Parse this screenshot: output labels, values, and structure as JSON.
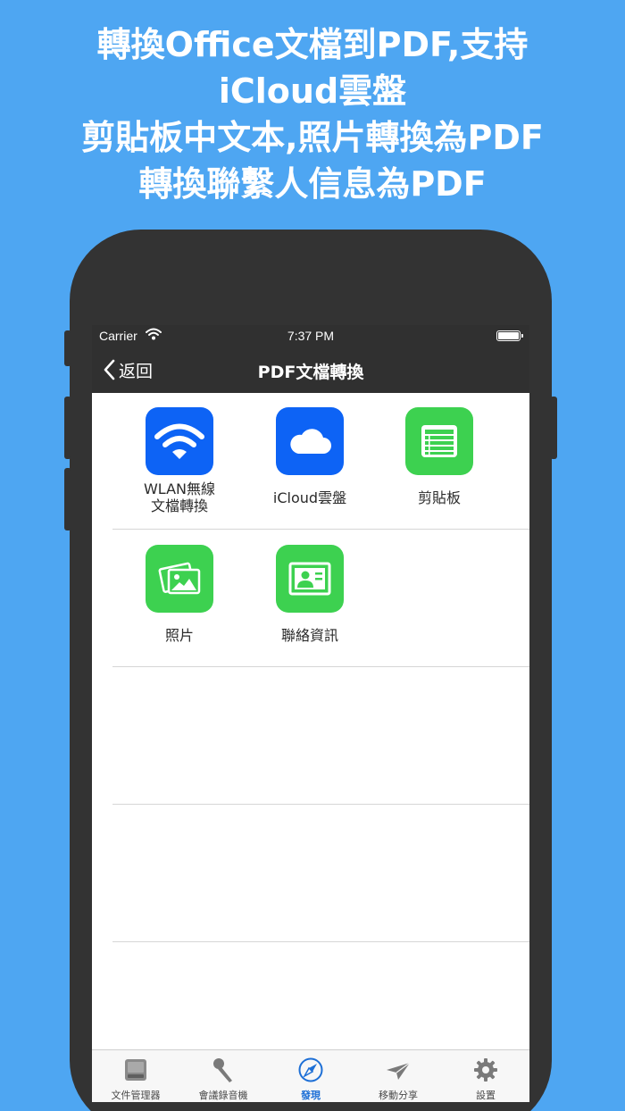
{
  "headline": {
    "lines": [
      "轉換Office文檔到PDF,支持",
      "iCloud雲盤",
      "剪貼板中文本,照片轉換為PDF",
      "轉換聯繫人信息為PDF"
    ]
  },
  "status_bar": {
    "carrier": "Carrier",
    "time": "7:37 PM"
  },
  "nav": {
    "back_label": "返回",
    "title": "PDF文檔轉換"
  },
  "tiles": [
    {
      "label_line1": "WLAN無線",
      "label_line2": "文檔轉換",
      "icon": "wifi-icon",
      "color": "#0d63f5"
    },
    {
      "label_line1": "iCloud雲盤",
      "label_line2": "",
      "icon": "cloud-icon",
      "color": "#0d63f5"
    },
    {
      "label_line1": "剪貼板",
      "label_line2": "",
      "icon": "clipboard-list-icon",
      "color": "#3dd150"
    },
    {
      "label_line1": "照片",
      "label_line2": "",
      "icon": "photos-icon",
      "color": "#3dd150"
    },
    {
      "label_line1": "聯絡資訊",
      "label_line2": "",
      "icon": "contact-card-icon",
      "color": "#3dd150"
    }
  ],
  "tabbar": {
    "tabs": [
      {
        "label": "文件管理器",
        "icon": "drive-icon",
        "active": false
      },
      {
        "label": "會議錄音機",
        "icon": "microphone-icon",
        "active": false
      },
      {
        "label": "發現",
        "icon": "compass-icon",
        "active": true
      },
      {
        "label": "移動分享",
        "icon": "paper-plane-icon",
        "active": false
      },
      {
        "label": "設置",
        "icon": "gear-icon",
        "active": false
      }
    ]
  },
  "colors": {
    "background": "#4ea6f2",
    "phone_body": "#333333",
    "nav_bar": "#303030",
    "active_tab": "#1d6fd6"
  }
}
